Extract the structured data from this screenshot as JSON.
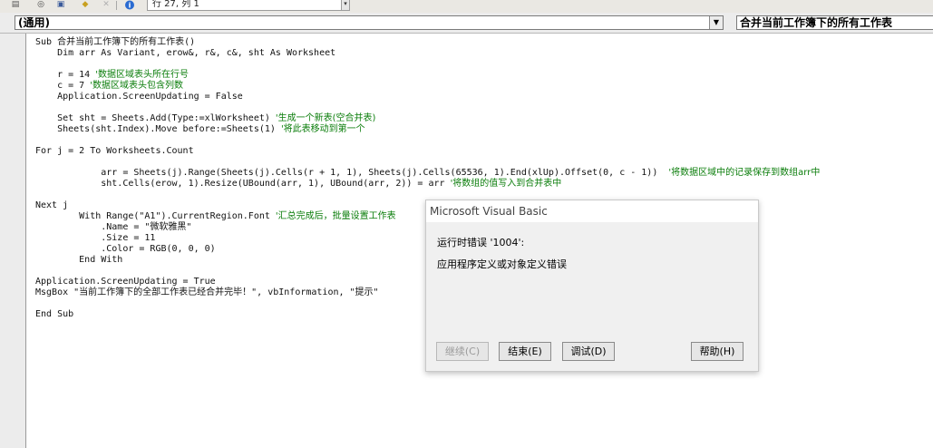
{
  "toolbar": {
    "icons": [
      "form-icon",
      "view-icon",
      "lock-icon",
      "key-icon",
      "close-icon",
      "help-icon"
    ],
    "status_text": "行 27, 列 1"
  },
  "combo": {
    "left_value": "(通用)",
    "right_value": "合并当前工作簿下的所有工作表"
  },
  "code": {
    "lines": [
      {
        "text": "Sub 合并当前工作簿下的所有工作表()",
        "comment": ""
      },
      {
        "text": "    Dim arr As Variant, erow&, r&, c&, sht As Worksheet",
        "comment": ""
      },
      {
        "text": "",
        "comment": ""
      },
      {
        "text": "    r = 14 ",
        "comment": "'数据区域表头所在行号"
      },
      {
        "text": "    c = 7 ",
        "comment": "'数据区域表头包含列数"
      },
      {
        "text": "    Application.ScreenUpdating = False",
        "comment": ""
      },
      {
        "text": "",
        "comment": ""
      },
      {
        "text": "    Set sht = Sheets.Add(Type:=xlWorksheet) ",
        "comment": "'生成一个新表(空合并表)"
      },
      {
        "text": "    Sheets(sht.Index).Move before:=Sheets(1) ",
        "comment": "'将此表移动到第一个"
      },
      {
        "text": "",
        "comment": ""
      },
      {
        "text": "For j = 2 To Worksheets.Count",
        "comment": ""
      },
      {
        "text": "",
        "comment": ""
      },
      {
        "text": "            arr = Sheets(j).Range(Sheets(j).Cells(r + 1, 1), Sheets(j).Cells(65536, 1).End(xlUp).Offset(0, c - 1))  ",
        "comment": "'将数据区域中的记录保存到数组arr中"
      },
      {
        "text": "            sht.Cells(erow, 1).Resize(UBound(arr, 1), UBound(arr, 2)) = arr ",
        "comment": "'将数组的值写入到合并表中"
      },
      {
        "text": "",
        "comment": ""
      },
      {
        "text": "Next j",
        "comment": ""
      },
      {
        "text": "        With Range(\"A1\").CurrentRegion.Font ",
        "comment": "'汇总完成后，批量设置工作表"
      },
      {
        "text": "            .Name = \"微软雅黑\"",
        "comment": ""
      },
      {
        "text": "            .Size = 11",
        "comment": ""
      },
      {
        "text": "            .Color = RGB(0, 0, 0)",
        "comment": ""
      },
      {
        "text": "        End With",
        "comment": ""
      },
      {
        "text": "",
        "comment": ""
      },
      {
        "text": "Application.ScreenUpdating = True",
        "comment": ""
      },
      {
        "text": "MsgBox \"当前工作簿下的全部工作表已经合并完毕！\", vbInformation, \"提示\"",
        "comment": ""
      },
      {
        "text": "",
        "comment": ""
      },
      {
        "text": "End Sub",
        "comment": ""
      }
    ]
  },
  "dialog": {
    "title": "Microsoft Visual Basic",
    "error_line": "运行时错误 '1004':",
    "description": "应用程序定义或对象定义错误",
    "buttons": {
      "continue": "继续(C)",
      "end": "结束(E)",
      "debug": "调试(D)",
      "help": "帮助(H)"
    }
  }
}
